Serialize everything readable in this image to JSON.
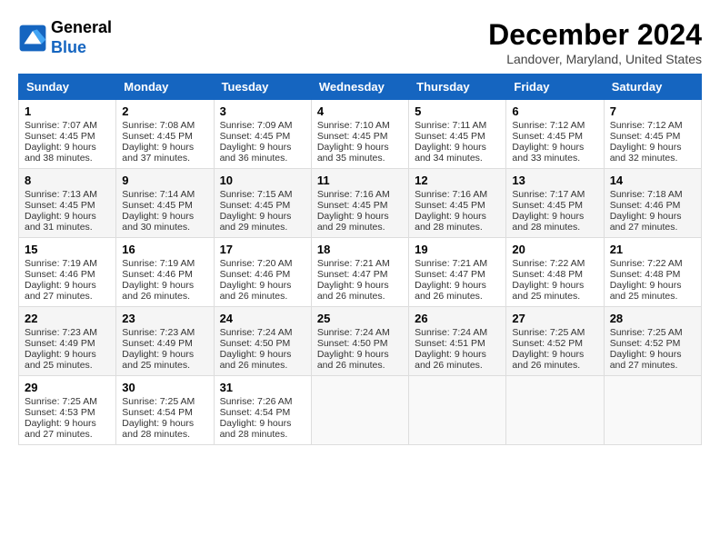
{
  "header": {
    "logo_line1": "General",
    "logo_line2": "Blue",
    "month_title": "December 2024",
    "location": "Landover, Maryland, United States"
  },
  "days_of_week": [
    "Sunday",
    "Monday",
    "Tuesday",
    "Wednesday",
    "Thursday",
    "Friday",
    "Saturday"
  ],
  "weeks": [
    [
      {
        "day": "1",
        "sunrise": "7:07 AM",
        "sunset": "4:45 PM",
        "daylight": "9 hours and 38 minutes."
      },
      {
        "day": "2",
        "sunrise": "7:08 AM",
        "sunset": "4:45 PM",
        "daylight": "9 hours and 37 minutes."
      },
      {
        "day": "3",
        "sunrise": "7:09 AM",
        "sunset": "4:45 PM",
        "daylight": "9 hours and 36 minutes."
      },
      {
        "day": "4",
        "sunrise": "7:10 AM",
        "sunset": "4:45 PM",
        "daylight": "9 hours and 35 minutes."
      },
      {
        "day": "5",
        "sunrise": "7:11 AM",
        "sunset": "4:45 PM",
        "daylight": "9 hours and 34 minutes."
      },
      {
        "day": "6",
        "sunrise": "7:12 AM",
        "sunset": "4:45 PM",
        "daylight": "9 hours and 33 minutes."
      },
      {
        "day": "7",
        "sunrise": "7:12 AM",
        "sunset": "4:45 PM",
        "daylight": "9 hours and 32 minutes."
      }
    ],
    [
      {
        "day": "8",
        "sunrise": "7:13 AM",
        "sunset": "4:45 PM",
        "daylight": "9 hours and 31 minutes."
      },
      {
        "day": "9",
        "sunrise": "7:14 AM",
        "sunset": "4:45 PM",
        "daylight": "9 hours and 30 minutes."
      },
      {
        "day": "10",
        "sunrise": "7:15 AM",
        "sunset": "4:45 PM",
        "daylight": "9 hours and 29 minutes."
      },
      {
        "day": "11",
        "sunrise": "7:16 AM",
        "sunset": "4:45 PM",
        "daylight": "9 hours and 29 minutes."
      },
      {
        "day": "12",
        "sunrise": "7:16 AM",
        "sunset": "4:45 PM",
        "daylight": "9 hours and 28 minutes."
      },
      {
        "day": "13",
        "sunrise": "7:17 AM",
        "sunset": "4:45 PM",
        "daylight": "9 hours and 28 minutes."
      },
      {
        "day": "14",
        "sunrise": "7:18 AM",
        "sunset": "4:46 PM",
        "daylight": "9 hours and 27 minutes."
      }
    ],
    [
      {
        "day": "15",
        "sunrise": "7:19 AM",
        "sunset": "4:46 PM",
        "daylight": "9 hours and 27 minutes."
      },
      {
        "day": "16",
        "sunrise": "7:19 AM",
        "sunset": "4:46 PM",
        "daylight": "9 hours and 26 minutes."
      },
      {
        "day": "17",
        "sunrise": "7:20 AM",
        "sunset": "4:46 PM",
        "daylight": "9 hours and 26 minutes."
      },
      {
        "day": "18",
        "sunrise": "7:21 AM",
        "sunset": "4:47 PM",
        "daylight": "9 hours and 26 minutes."
      },
      {
        "day": "19",
        "sunrise": "7:21 AM",
        "sunset": "4:47 PM",
        "daylight": "9 hours and 26 minutes."
      },
      {
        "day": "20",
        "sunrise": "7:22 AM",
        "sunset": "4:48 PM",
        "daylight": "9 hours and 25 minutes."
      },
      {
        "day": "21",
        "sunrise": "7:22 AM",
        "sunset": "4:48 PM",
        "daylight": "9 hours and 25 minutes."
      }
    ],
    [
      {
        "day": "22",
        "sunrise": "7:23 AM",
        "sunset": "4:49 PM",
        "daylight": "9 hours and 25 minutes."
      },
      {
        "day": "23",
        "sunrise": "7:23 AM",
        "sunset": "4:49 PM",
        "daylight": "9 hours and 25 minutes."
      },
      {
        "day": "24",
        "sunrise": "7:24 AM",
        "sunset": "4:50 PM",
        "daylight": "9 hours and 26 minutes."
      },
      {
        "day": "25",
        "sunrise": "7:24 AM",
        "sunset": "4:50 PM",
        "daylight": "9 hours and 26 minutes."
      },
      {
        "day": "26",
        "sunrise": "7:24 AM",
        "sunset": "4:51 PM",
        "daylight": "9 hours and 26 minutes."
      },
      {
        "day": "27",
        "sunrise": "7:25 AM",
        "sunset": "4:52 PM",
        "daylight": "9 hours and 26 minutes."
      },
      {
        "day": "28",
        "sunrise": "7:25 AM",
        "sunset": "4:52 PM",
        "daylight": "9 hours and 27 minutes."
      }
    ],
    [
      {
        "day": "29",
        "sunrise": "7:25 AM",
        "sunset": "4:53 PM",
        "daylight": "9 hours and 27 minutes."
      },
      {
        "day": "30",
        "sunrise": "7:25 AM",
        "sunset": "4:54 PM",
        "daylight": "9 hours and 28 minutes."
      },
      {
        "day": "31",
        "sunrise": "7:26 AM",
        "sunset": "4:54 PM",
        "daylight": "9 hours and 28 minutes."
      },
      null,
      null,
      null,
      null
    ]
  ]
}
